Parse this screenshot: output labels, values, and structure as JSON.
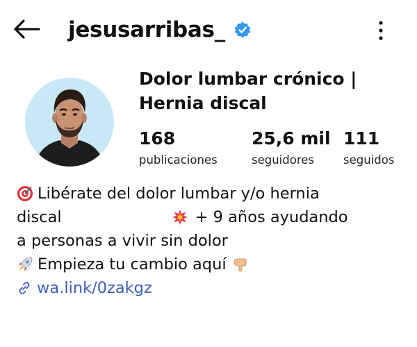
{
  "header": {
    "username": "jesusarribas_",
    "back_icon": "arrow-left-icon",
    "verified_icon": "verified-badge-icon",
    "more_icon": "more-vertical-icon",
    "verified_color": "#3897f0"
  },
  "profile": {
    "name_line1": "Dolor lumbar crónico |",
    "name_line2": "Hernia discal",
    "avatar_background": "#c9e8f5"
  },
  "stats": [
    {
      "value": "168",
      "label": "publicaciones"
    },
    {
      "value": "25,6 mil",
      "label": "seguidores"
    },
    {
      "value": "111",
      "label": "seguidos"
    }
  ],
  "bio": {
    "line1": "Libérate del dolor lumbar y/o hernia",
    "line2a": "discal",
    "line2b": "+ 9 años ayudando",
    "line3": "a personas a vivir sin dolor",
    "line4": "Empieza tu cambio aquí",
    "emojis": [
      "target-icon",
      "collision-icon",
      "rocket-icon",
      "pointing-down-hand-icon"
    ]
  },
  "link": {
    "text": "wa.link/0zakgz",
    "icon": "link-icon",
    "color": "#3b5fb5"
  }
}
